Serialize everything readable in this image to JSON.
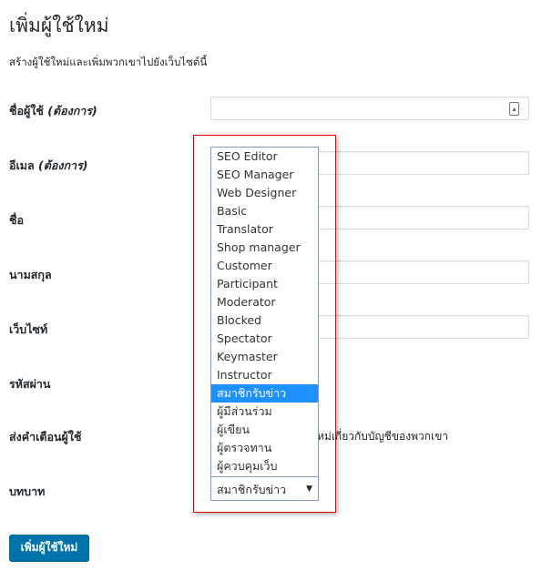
{
  "title": "เพิ่มผู้ใช้ใหม่",
  "subtitle": "สร้างผู้ใช้ใหม่และเพิ่มพวกเขาไปยังเว็บไซต์นี้",
  "fields": {
    "username": {
      "label": "ชื่อผู้ใช้",
      "required": "(ต้องการ)",
      "value": ""
    },
    "email": {
      "label": "อีเมล",
      "required": "(ต้องการ)",
      "value": ""
    },
    "first_name": {
      "label": "ชื่อ",
      "value": ""
    },
    "last_name": {
      "label": "นามสกุล",
      "value": ""
    },
    "website": {
      "label": "เว็บไซท์",
      "value": ""
    },
    "password": {
      "label": "รหัสผ่าน"
    },
    "notify": {
      "label": "ส่งคำเตือนผู้ใช้",
      "text_visible": "หม่เกี่ยวกับบัญชีของพวกเขา"
    },
    "role": {
      "label": "บทบาท",
      "selected": "สมาชิกรับข่าว"
    }
  },
  "role_options": [
    "SEO Editor",
    "SEO Manager",
    "Web Designer",
    "Basic",
    "Translator",
    "Shop manager",
    "Customer",
    "Participant",
    "Moderator",
    "Blocked",
    "Spectator",
    "Keymaster",
    "Instructor",
    "สมาชิกรับข่าว",
    "ผู้มีส่วนร่วม",
    "ผู้เขียน",
    "ผู้ตรวจทาน",
    "ผู้ควบคุมเว็บ"
  ],
  "highlighted_option": "สมาชิกรับข่าว",
  "submit_label": "เพิ่มผู้ใช้ใหม่"
}
